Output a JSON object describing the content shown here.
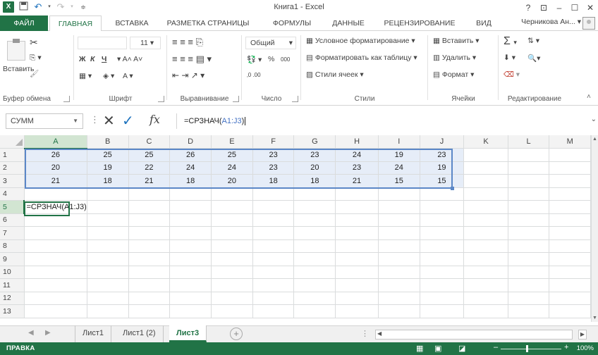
{
  "window": {
    "title": "Книга1 - Excel",
    "app_icon": "X",
    "help": "?",
    "controls": [
      "restore-ribbon-icon",
      "minimize-icon",
      "maximize-icon",
      "close-icon"
    ]
  },
  "colors": {
    "accent": "#217346",
    "range_highlight": "#e6edf8",
    "range_border": "#5b87c7",
    "formula_ref": "#4472c4"
  },
  "tabs": [
    {
      "label": "ФАЙЛ"
    },
    {
      "label": "ГЛАВНАЯ"
    },
    {
      "label": "ВСТАВКА"
    },
    {
      "label": "РАЗМЕТКА СТРАНИЦЫ"
    },
    {
      "label": "ФОРМУЛЫ"
    },
    {
      "label": "ДАННЫЕ"
    },
    {
      "label": "РЕЦЕНЗИРОВАНИЕ"
    },
    {
      "label": "ВИД"
    }
  ],
  "user": {
    "name": "Черникова Ан..."
  },
  "ribbon": {
    "clipboard": {
      "paste": "Вставить",
      "label": "Буфер обмена"
    },
    "font": {
      "size": "11",
      "bold": "Ж",
      "italic": "К",
      "underline": "Ч",
      "label": "Шрифт"
    },
    "alignment": {
      "label": "Выравнивание"
    },
    "number": {
      "format": "Общий",
      "percent": "%",
      "thousands": "000",
      "label": "Число"
    },
    "styles": {
      "conditional": "Условное форматирование",
      "as_table": "Форматировать как таблицу",
      "cell_styles": "Стили ячеек",
      "label": "Стили"
    },
    "cells": {
      "insert": "Вставить",
      "delete": "Удалить",
      "format": "Формат",
      "label": "Ячейки"
    },
    "editing": {
      "label": "Редактирование"
    }
  },
  "formula_bar": {
    "name_box": "СУММ",
    "formula_prefix": "=СРЗНАЧ(",
    "formula_ref": "A1:J3",
    "formula_suffix": ")"
  },
  "grid": {
    "columns": [
      "A",
      "B",
      "C",
      "D",
      "E",
      "F",
      "G",
      "H",
      "I",
      "J",
      "K",
      "L",
      "M"
    ],
    "rows": [
      "1",
      "2",
      "3",
      "4",
      "5",
      "6",
      "7",
      "8",
      "9",
      "10",
      "11",
      "12",
      "13"
    ],
    "data": [
      [
        "26",
        "25",
        "25",
        "26",
        "25",
        "23",
        "23",
        "24",
        "19",
        "23"
      ],
      [
        "20",
        "19",
        "22",
        "24",
        "24",
        "23",
        "20",
        "23",
        "24",
        "19"
      ],
      [
        "21",
        "18",
        "21",
        "18",
        "20",
        "18",
        "18",
        "21",
        "15",
        "15"
      ]
    ],
    "active_cell": {
      "ref": "A5",
      "content": "=СРЗНАЧ(A1:J3)"
    }
  },
  "sheets": [
    {
      "name": "Лист1",
      "active": false
    },
    {
      "name": "Лист1 (2)",
      "active": false
    },
    {
      "name": "Лист3",
      "active": true
    }
  ],
  "status": {
    "mode": "ПРАВКА",
    "zoom": "100%"
  }
}
